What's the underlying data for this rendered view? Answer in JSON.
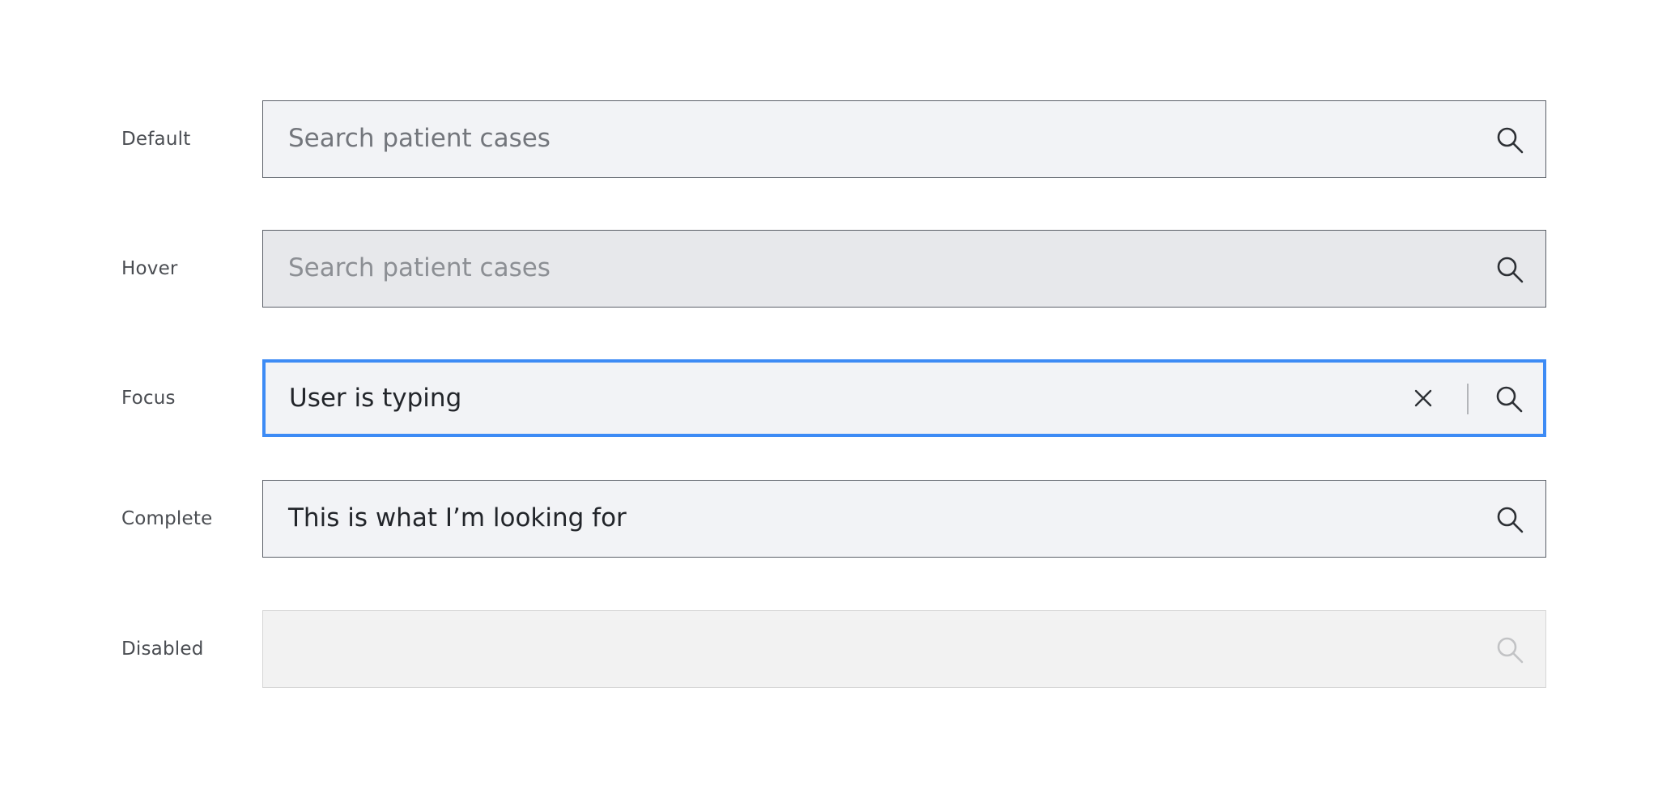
{
  "rows": [
    {
      "label": "Default",
      "placeholder": "Search patient cases",
      "value": ""
    },
    {
      "label": "Hover",
      "placeholder": "Search patient cases",
      "value": ""
    },
    {
      "label": "Focus",
      "placeholder": "",
      "value": "User is typing"
    },
    {
      "label": "Complete",
      "placeholder": "",
      "value": "This is what I’m looking for"
    },
    {
      "label": "Disabled",
      "placeholder": "",
      "value": ""
    }
  ],
  "colors": {
    "focus_border": "#3d8bf5",
    "field_background": "#f2f3f6",
    "hover_background": "#e7e8eb",
    "disabled_background": "#f2f2f2",
    "border": "#5b6068"
  },
  "icons": {
    "search": "search-icon",
    "clear": "close-icon"
  }
}
